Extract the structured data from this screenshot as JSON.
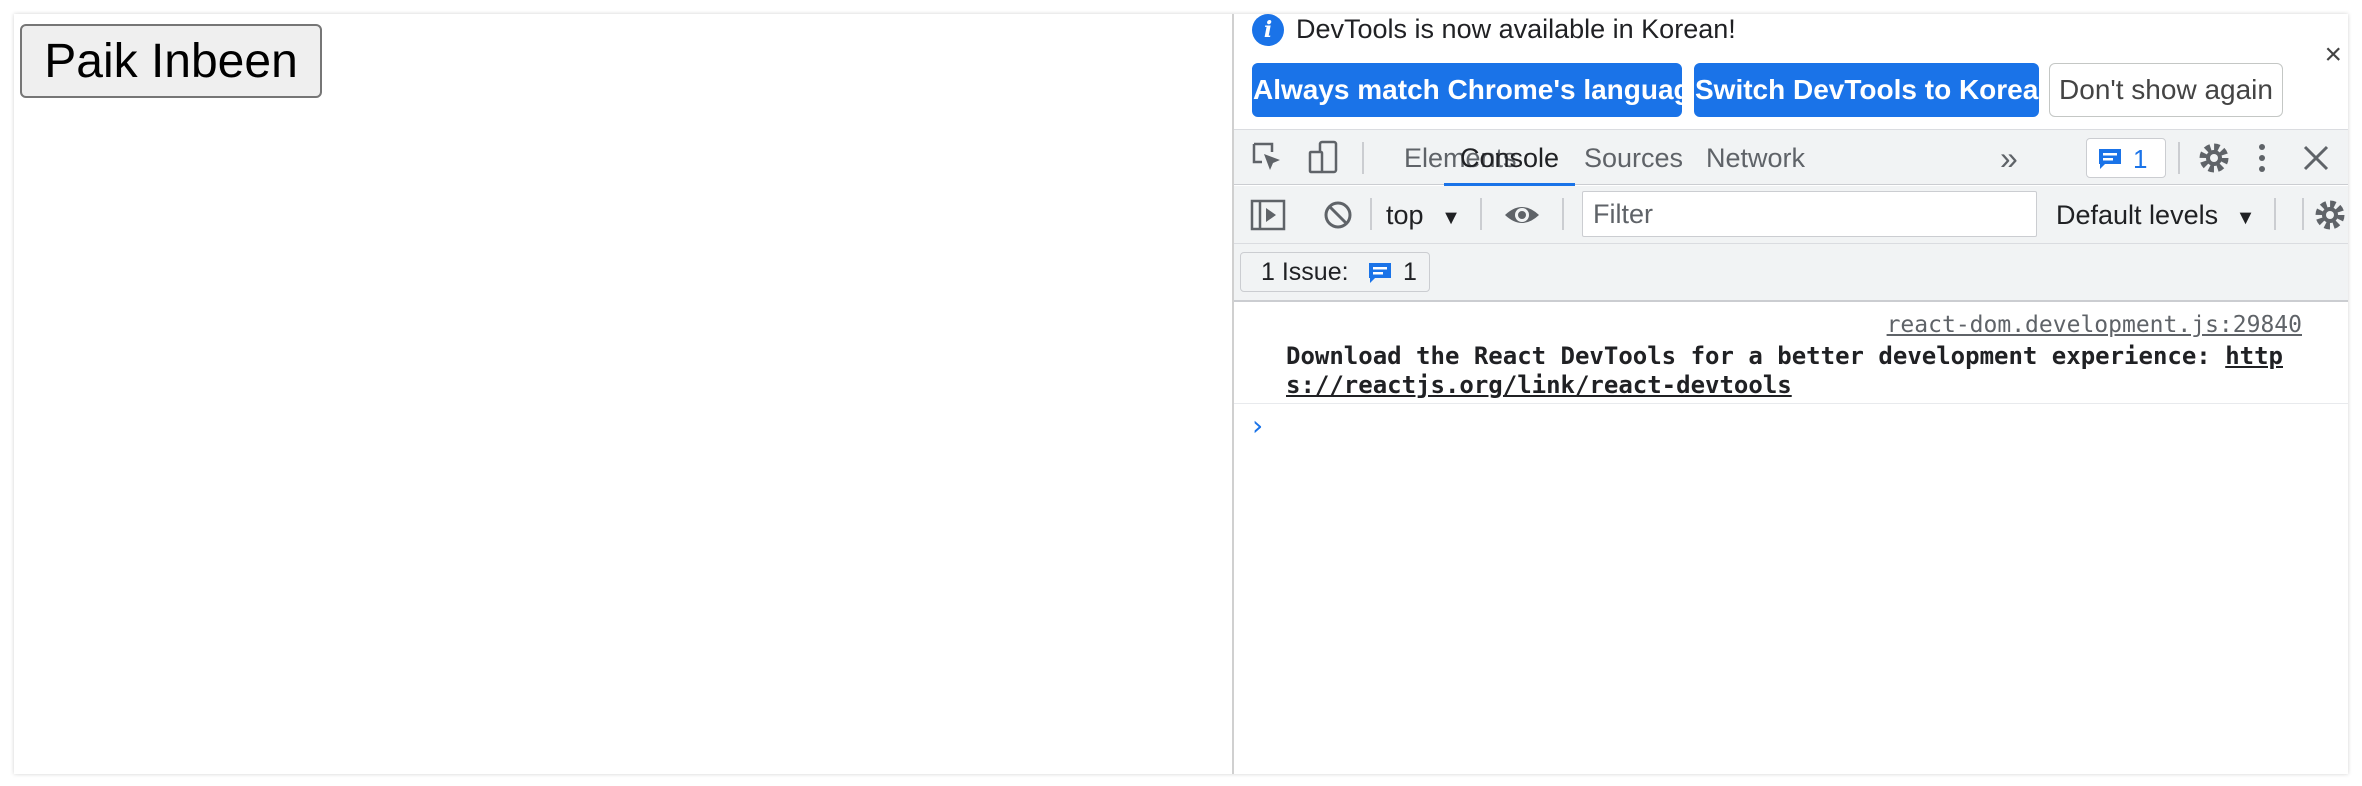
{
  "page": {
    "button_label": "Paik Inbeen"
  },
  "devtools": {
    "infobar": {
      "message": "DevTools is now available in Korean!",
      "icon": "info-icon",
      "primary_button": "Always match Chrome's language",
      "secondary_button": "Switch DevTools to Korean",
      "tertiary_button": "Don't show again",
      "close_glyph": "×"
    },
    "tabs": [
      {
        "label": "Elements",
        "active": false
      },
      {
        "label": "Console",
        "active": true
      },
      {
        "label": "Sources",
        "active": false
      },
      {
        "label": "Network",
        "active": false
      }
    ],
    "more_tabs_glyph": "»",
    "issue_badge_count": "1",
    "console_toolbar": {
      "context": "top",
      "filter_placeholder": "Filter",
      "levels": "Default levels"
    },
    "issues_row": {
      "label": "1 Issue:",
      "count": "1"
    },
    "messages": [
      {
        "source": "react-dom.development.js:29840",
        "text": "Download the React DevTools for a better development experience: ",
        "link": "https://reactjs.org/link/react-devtools"
      }
    ],
    "prompt_glyph": "›"
  },
  "colors": {
    "accent": "#1a73e8",
    "toolbar_bg": "#f1f3f4",
    "text": "#202124",
    "muted": "#5f6368"
  }
}
